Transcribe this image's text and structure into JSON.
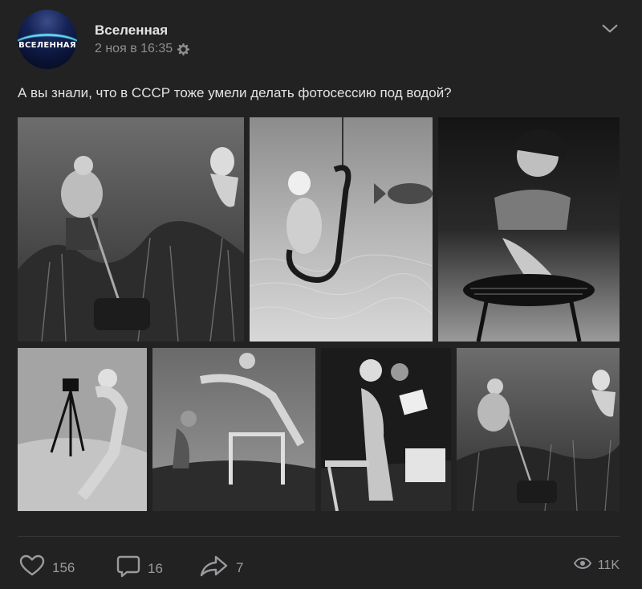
{
  "header": {
    "author_name": "Вселенная",
    "date": "2 ноя в 16:35",
    "avatar_text": "ВСЕЛЕННАЯ"
  },
  "post": {
    "text": "А вы знали, что в СССР тоже умели делать фотосессию под водой?"
  },
  "photos": [
    {
      "subject": "man mowing underwater with woman swimming"
    },
    {
      "subject": "woman on fishing hook with fish"
    },
    {
      "subject": "woman at underwater barbecue grill"
    },
    {
      "subject": "woman with camera on tripod"
    },
    {
      "subject": "man photographing woman jumping hurdle"
    },
    {
      "subject": "couple reading newspaper on chairs"
    },
    {
      "subject": "man mowing underwater with woman"
    }
  ],
  "footer": {
    "likes": "156",
    "comments": "16",
    "shares": "7",
    "views": "11K"
  },
  "colors": {
    "background": "#222222",
    "text_primary": "#e1e3e6",
    "text_secondary": "#8d8f93",
    "icon": "#9a9b9f"
  },
  "icons": [
    "gear-icon",
    "chevron-down-icon",
    "heart-icon",
    "comment-icon",
    "share-icon",
    "eye-icon"
  ]
}
